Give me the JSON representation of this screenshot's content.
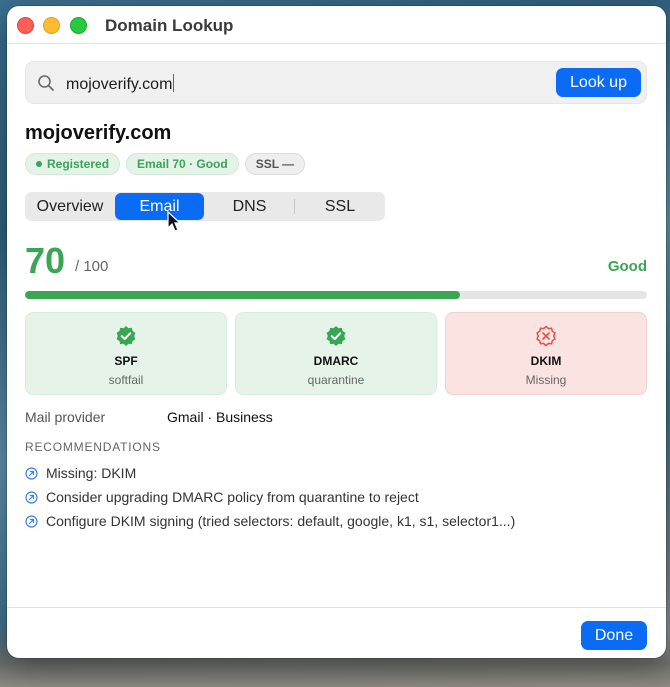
{
  "window": {
    "title": "Domain Lookup"
  },
  "search": {
    "value": "mojoverify.com",
    "button_label": "Look up"
  },
  "domain": {
    "name": "mojoverify.com"
  },
  "badges": [
    {
      "label": "Registered",
      "style": "green",
      "dot": true
    },
    {
      "label": "Email 70 · Good",
      "style": "green",
      "dot": false
    },
    {
      "label": "SSL —",
      "style": "gray",
      "dot": false
    }
  ],
  "tabs": [
    {
      "label": "Overview",
      "active": false
    },
    {
      "label": "Email",
      "active": true
    },
    {
      "label": "DNS",
      "active": false
    },
    {
      "label": "SSL",
      "active": false
    }
  ],
  "score": {
    "value": "70",
    "max": "/ 100",
    "label": "Good",
    "fraction": 0.7,
    "color": "#3aa653"
  },
  "checks": [
    {
      "name": "SPF",
      "status": "softfail",
      "state": "ok",
      "icon": "check-badge-icon"
    },
    {
      "name": "DMARC",
      "status": "quarantine",
      "state": "ok",
      "icon": "check-badge-icon"
    },
    {
      "name": "DKIM",
      "status": "Missing",
      "state": "bad",
      "icon": "x-badge-icon"
    }
  ],
  "mail_provider": {
    "label": "Mail provider",
    "value": "Gmail · Business"
  },
  "recommendations": {
    "heading": "RECOMMENDATIONS",
    "items": [
      "Missing: DKIM",
      "Consider upgrading DMARC policy from quarantine to reject",
      "Configure DKIM signing (tried selectors: default, google, k1, s1, selector1...)"
    ]
  },
  "footer": {
    "done_label": "Done"
  },
  "colors": {
    "accent": "#0a6cf5",
    "good": "#3aa653",
    "bad": "#e0504a"
  }
}
